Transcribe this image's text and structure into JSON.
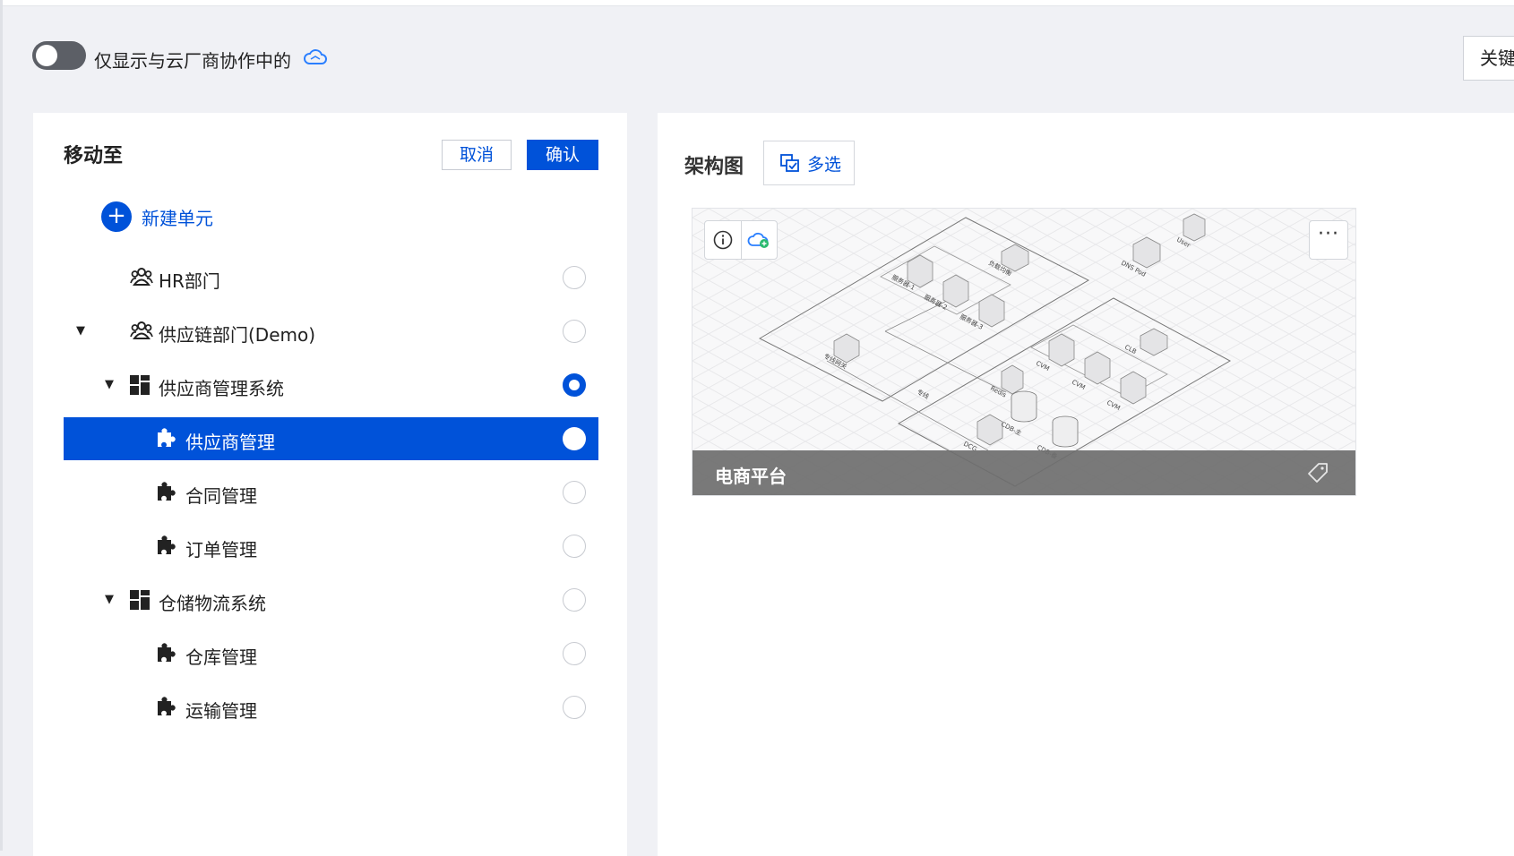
{
  "top": {
    "toggle_label": "仅显示与云厂商协作中的",
    "toggle_on": false,
    "keyword_button_partial": "关键"
  },
  "move_panel": {
    "title": "移动至",
    "cancel_label": "取消",
    "confirm_label": "确认",
    "new_unit_label": "新建单元",
    "tree": [
      {
        "label": "HR部门",
        "icon": "group-icon",
        "level": 0,
        "expanded": null,
        "checked": false,
        "selected": false
      },
      {
        "label": "供应链部门(Demo)",
        "icon": "group-icon",
        "level": 0,
        "expanded": true,
        "checked": false,
        "selected": false
      },
      {
        "label": "供应商管理系统",
        "icon": "apps-icon",
        "level": 1,
        "expanded": true,
        "checked": true,
        "selected": false
      },
      {
        "label": "供应商管理",
        "icon": "puzzle-icon",
        "level": 2,
        "expanded": null,
        "checked": false,
        "selected": true
      },
      {
        "label": "合同管理",
        "icon": "puzzle-icon",
        "level": 2,
        "expanded": null,
        "checked": false,
        "selected": false
      },
      {
        "label": "订单管理",
        "icon": "puzzle-icon",
        "level": 2,
        "expanded": null,
        "checked": false,
        "selected": false
      },
      {
        "label": "仓储物流系统",
        "icon": "apps-icon",
        "level": 1,
        "expanded": true,
        "checked": false,
        "selected": false
      },
      {
        "label": "仓库管理",
        "icon": "puzzle-icon",
        "level": 2,
        "expanded": null,
        "checked": false,
        "selected": false
      },
      {
        "label": "运输管理",
        "icon": "puzzle-icon",
        "level": 2,
        "expanded": null,
        "checked": false,
        "selected": false
      }
    ]
  },
  "arch_panel": {
    "title": "架构图",
    "multi_select_label": "多选",
    "cards": [
      {
        "name": "电商平台",
        "diagram_labels": [
          "服务器-1",
          "服务器-2",
          "服务器-3",
          "负载均衡",
          "DNS Pod",
          "User",
          "专线网关",
          "专线",
          "Redis",
          "CVM",
          "CVM",
          "CVM",
          "CLB",
          "CDB-主",
          "CDB-备",
          "DCG"
        ]
      }
    ]
  },
  "colors": {
    "primary": "#0052d9",
    "page_bg": "#f0f1f5",
    "toggle_off": "#5c5f66"
  }
}
